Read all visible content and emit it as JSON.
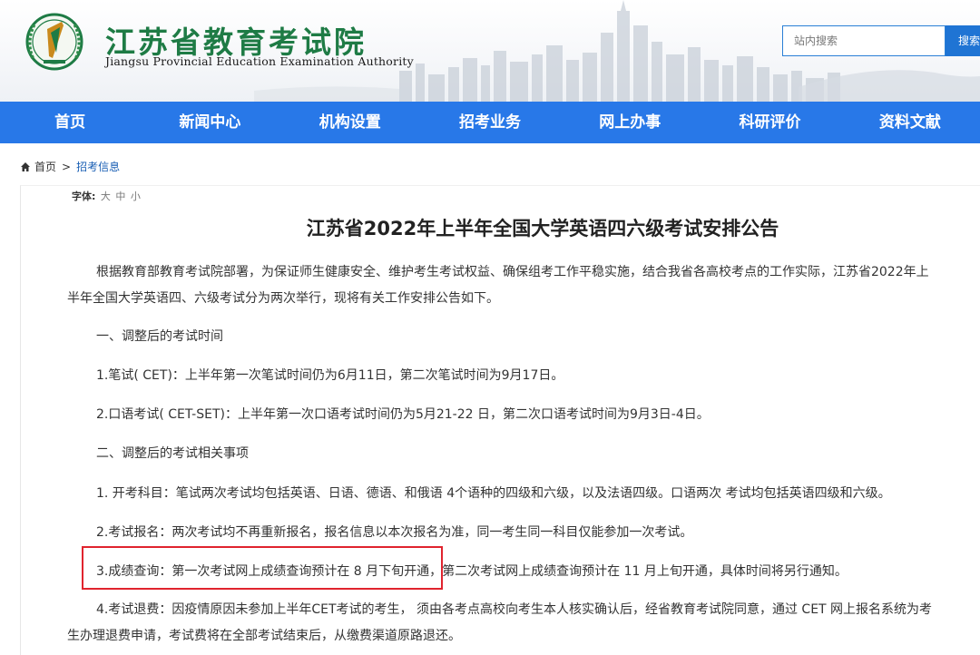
{
  "header": {
    "title": "江苏省教育考试院",
    "subtitle": "Jiangsu Provincial Education Examination Authority",
    "search_placeholder": "站内搜索",
    "search_button": "搜索"
  },
  "nav": {
    "items": [
      "首页",
      "新闻中心",
      "机构设置",
      "招考业务",
      "网上办事",
      "科研评价",
      "资料文献"
    ]
  },
  "breadcrumb": {
    "home": "首页",
    "separator": ">",
    "current": "招考信息"
  },
  "font_size": {
    "label": "字体:",
    "options": [
      "大",
      "中",
      "小"
    ]
  },
  "article": {
    "title": "江苏省2022年上半年全国大学英语四六级考试安排公告",
    "intro_line1": "根据教育部教育考试院部署，为保证师生健康安全、维护考生考试权益、确保组考工作平稳实施，结合我省各高校考点的工作实际，江苏省2022年上",
    "intro_line2": "半年全国大学英语四、六级考试分为两次举行，现将有关工作安排公告如下。",
    "section1": "一、调整后的考试时间",
    "item1": "1.笔试( CET)：上半年第一次笔试时间仍为6月11日，第二次笔试时间为9月17日。",
    "item2": "2.口语考试( CET-SET)：上半年第一次口语考试时间仍为5月21-22 日，第二次口语考试时间为9月3日-4日。",
    "section2": "二、调整后的考试相关事项",
    "item3": "1. 开考科目：笔试两次考试均包括英语、日语、德语、和俄语 4个语种的四级和六级，以及法语四级。口语两次 考试均包括英语四级和六级。",
    "item4": "2.考试报名：两次考试均不再重新报名，报名信息以本次报名为准，同一考生同一科目仅能参加一次考试。",
    "item5_part1": "3.成绩查询：第一次考试网上成绩查询预计在 8 月下旬开通，",
    "item5_part2": "第二次考试网上成绩查询预计在 11 月上旬开通，具体时间将另行通知。",
    "item6_line1": "4.考试退费：因疫情原因未参加上半年CET考试的考生， 须由各考点高校向考生本人核实确认后，经省教育考试院同意，通过 CET 网上报名系统为考",
    "item6_line2": "生办理退费申请，考试费将在全部考试结束后，从缴费渠道原路退还。"
  },
  "colors": {
    "nav_bg": "#2878e8",
    "title_green": "#1e7b45",
    "highlight_red": "#e0242e"
  }
}
